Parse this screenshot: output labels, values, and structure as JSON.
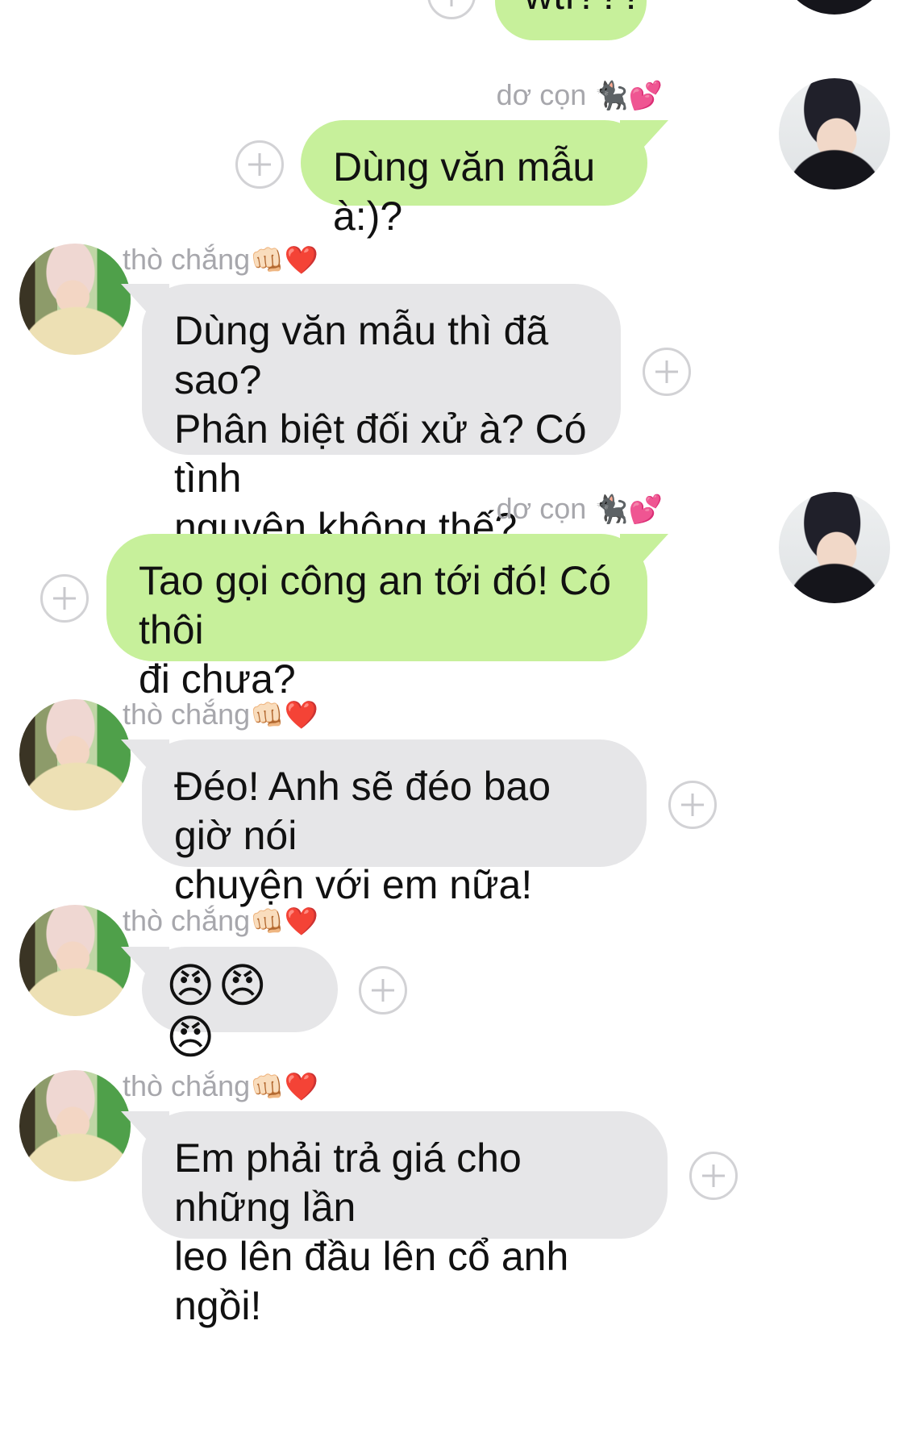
{
  "me": {
    "name": "dơ cọn",
    "name_emoji": "🐈‍⬛💕",
    "avatar": "male-avatar"
  },
  "other": {
    "name": "thò chắng",
    "name_emoji": "👊🏻❤️",
    "avatar": "blond-avatar"
  },
  "messages": [
    {
      "from": "me",
      "text": "wtf???"
    },
    {
      "from": "me",
      "text": "Dùng văn mẫu à:)?"
    },
    {
      "from": "other",
      "line1": "Dùng văn mẫu thì đã sao?",
      "line2": "Phân biệt đối xử à? Có tình",
      "line3": "nguyện không thế?"
    },
    {
      "from": "me",
      "line1": "Tao gọi công an tới đó! Có thôi",
      "line2": "đi chưa?"
    },
    {
      "from": "other",
      "line1": "Đéo! Anh sẽ đéo bao giờ nói",
      "line2": "chuyện với em nữa!"
    },
    {
      "from": "other",
      "text": "😠😠😠"
    },
    {
      "from": "other",
      "line1": "Em phải trả giá cho những lần",
      "line2": "leo lên đầu lên cổ anh ngồi!"
    }
  ],
  "colors": {
    "outgoing_bubble": "#c7f09b",
    "incoming_bubble": "#e6e6e8",
    "sender_name": "#a7a7ac"
  },
  "icons": {
    "add_reaction": "plus-circle-icon"
  }
}
